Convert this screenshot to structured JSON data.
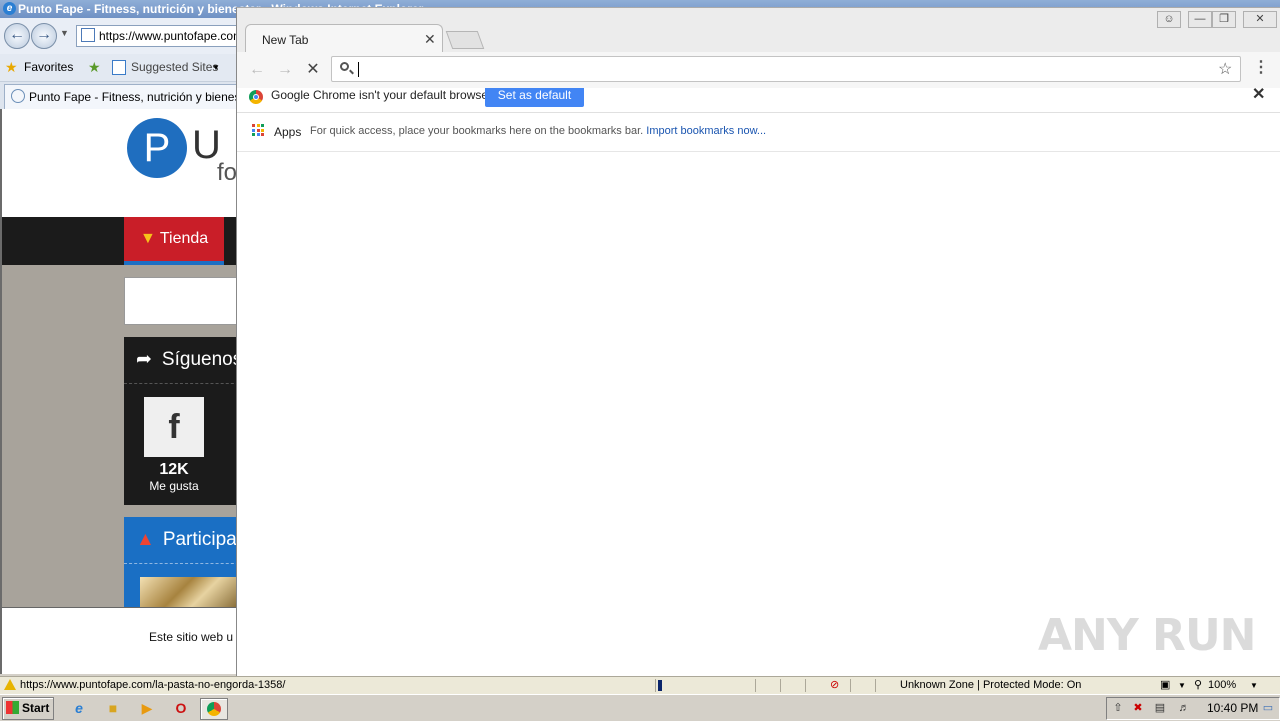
{
  "ie": {
    "title": "Punto Fape - Fitness, nutrición y bienestar - Windows Internet Explorer",
    "address": "https://www.puntofape.com",
    "favorites_label": "Favorites",
    "suggested_sites_label": "Suggested Sites",
    "tab_title": "Punto Fape - Fitness, nutrición y bienestar",
    "page": {
      "logo_letter": "P",
      "logo_u": "U",
      "logo_f": "fo",
      "nav_tienda": "Tienda",
      "siguenos": "Síguenos",
      "fb_letter": "f",
      "fb_count": "12K",
      "fb_label": "Me gusta",
      "participa": "Participa",
      "cookie_text": "Este sitio web u"
    },
    "status": {
      "url": "https://www.puntofape.com/la-pasta-no-engorda-1358/",
      "zone": "Unknown Zone | Protected Mode: On",
      "zoom": "100%"
    }
  },
  "chrome": {
    "tab_title": "New Tab",
    "omnibox_value": "",
    "infobar": {
      "message": "Google Chrome isn't your default browser.",
      "button": "Set as default"
    },
    "bookmarks": {
      "apps_label": "Apps",
      "hint": "For quick access, place your bookmarks here on the bookmarks bar.",
      "import_link": "Import bookmarks now..."
    },
    "accent_color": "#4285f4"
  },
  "taskbar": {
    "start_label": "Start",
    "clock": "10:40 PM"
  },
  "watermark": "ANY RUN"
}
